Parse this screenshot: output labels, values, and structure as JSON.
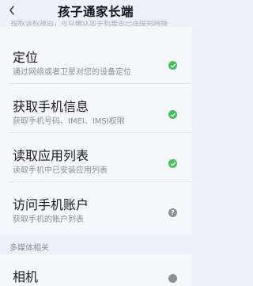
{
  "header": {
    "title": "孩子通家长端",
    "back_icon": "chevron-left-icon"
  },
  "peek_text": "授权该权限后，可以确认您手机是否已连接到网络",
  "permissions": [
    {
      "name": "定位",
      "desc": "通过网络或者卫星对您的设备定位",
      "status": "granted",
      "icon": "check-icon"
    },
    {
      "name": "获取手机信息",
      "desc": "获取手机号码、IMEI、IMSI权限",
      "status": "granted",
      "icon": "check-icon"
    },
    {
      "name": "读取应用列表",
      "desc": "读取手机中已安装应用列表",
      "status": "granted",
      "icon": "check-icon"
    },
    {
      "name": "访问手机账户",
      "desc": "获取手机的账户列表",
      "status": "unknown",
      "icon": "question-icon",
      "mark": "?"
    }
  ],
  "section": {
    "title": "多媒体相关"
  },
  "bottom_item": {
    "name": "相机",
    "status": "unknown"
  },
  "colors": {
    "granted": "#43c15e",
    "unknown": "#8d8f94",
    "background": "#eef0f6"
  }
}
